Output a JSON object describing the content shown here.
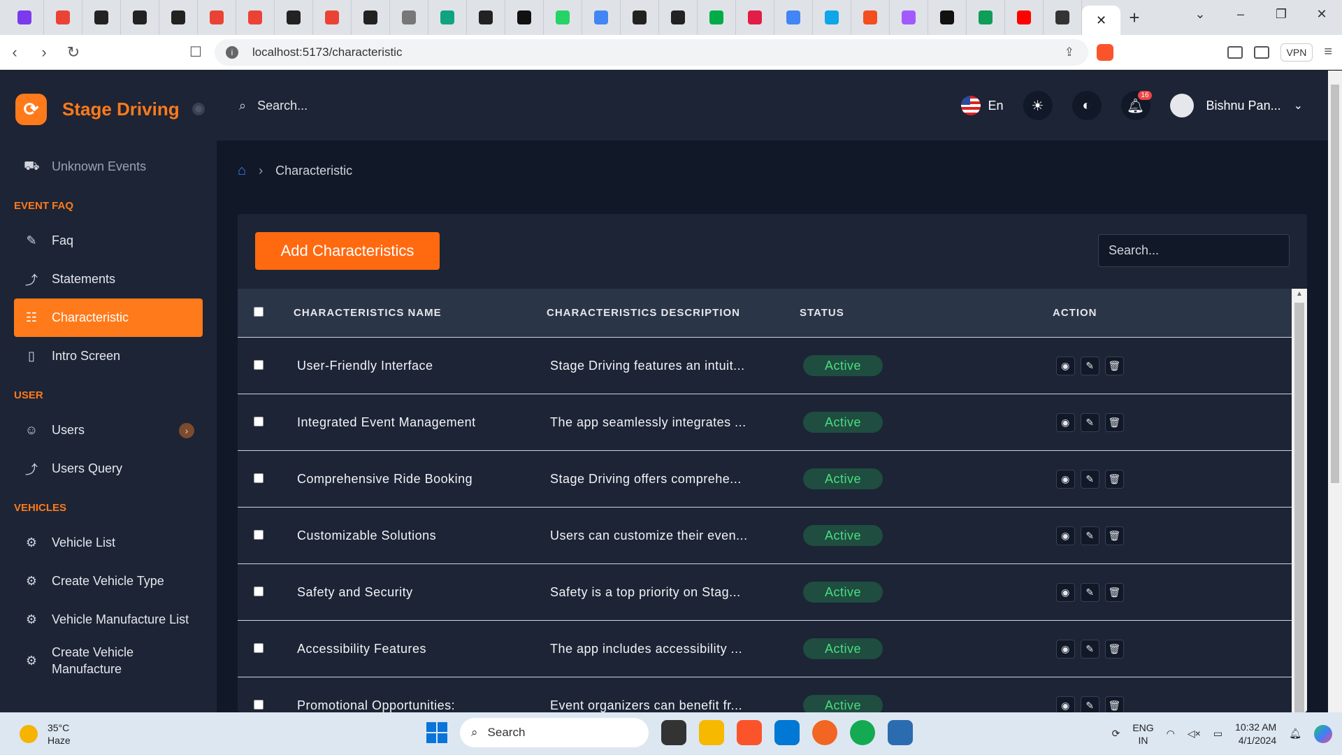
{
  "browser": {
    "tab_icons": [
      "app-icon",
      "gmail-icon",
      "github-icon",
      "github-icon",
      "github-icon",
      "gmail-icon",
      "gmail-icon",
      "github-icon",
      "gmail-icon",
      "github-icon",
      "globe-icon",
      "chatgpt-icon",
      "github-icon",
      "ycombinator-icon",
      "whatsapp-icon",
      "docs-icon",
      "github-icon",
      "github-icon",
      "meet-icon",
      "notion-icon",
      "docs-icon",
      "app-icon",
      "figma-icon",
      "figma-icon",
      "mongodb-icon",
      "sheets-icon",
      "youtube-icon",
      "compass-icon"
    ],
    "tab_colors": [
      "#7c3aed",
      "#ea4335",
      "#222",
      "#222",
      "#222",
      "#ea4335",
      "#ea4335",
      "#222",
      "#ea4335",
      "#222",
      "#777",
      "#10a37f",
      "#222",
      "#111",
      "#25d366",
      "#4285f4",
      "#222",
      "#222",
      "#00ac47",
      "#e11d48",
      "#4285f4",
      "#0ea5e9",
      "#f24e1e",
      "#a259ff",
      "#111",
      "#0f9d58",
      "#ff0000",
      "#333"
    ],
    "url": "localhost:5173/characteristic",
    "vpn_label": "VPN",
    "new_tab": "+",
    "close_tab": "✕"
  },
  "app": {
    "brand_name": "Stage Driving",
    "search_placeholder": "Search...",
    "language": "En",
    "notifications_count": "16",
    "user_name": "Bishnu Pan...",
    "sidebar": {
      "items_top": [
        {
          "label": "Unknown Events",
          "icon": "⛟"
        }
      ],
      "sections": [
        {
          "title": "EVENT FAQ",
          "items": [
            {
              "label": "Faq",
              "icon": "✎"
            },
            {
              "label": "Statements",
              "icon": "⤴"
            },
            {
              "label": "Characteristic",
              "icon": "☷",
              "active": true
            },
            {
              "label": "Intro Screen",
              "icon": "▯"
            }
          ]
        },
        {
          "title": "USER",
          "items": [
            {
              "label": "Users",
              "icon": "☺",
              "chevron": "›"
            },
            {
              "label": "Users Query",
              "icon": "⤴"
            }
          ]
        },
        {
          "title": "VEHICLES",
          "items": [
            {
              "label": "Vehicle List",
              "icon": "⚙"
            },
            {
              "label": "Create Vehicle Type",
              "icon": "⚙"
            },
            {
              "label": "Vehicle Manufacture List",
              "icon": "⚙"
            },
            {
              "label": "Create Vehicle Manufacture",
              "icon": "⚙"
            }
          ]
        }
      ]
    },
    "breadcrumb": {
      "current": "Characteristic"
    },
    "card": {
      "add_button": "Add Characteristics",
      "search_placeholder": "Search...",
      "columns": [
        "CHARACTERISTICS NAME",
        "CHARACTERISTICS DESCRIPTION",
        "STATUS",
        "ACTION"
      ],
      "rows": [
        {
          "name": "User-Friendly Interface",
          "description": "Stage Driving features an intuit...",
          "status": "Active"
        },
        {
          "name": "Integrated Event Management",
          "description": "The app seamlessly integrates ...",
          "status": "Active"
        },
        {
          "name": "Comprehensive Ride Booking",
          "description": "Stage Driving offers comprehe...",
          "status": "Active"
        },
        {
          "name": "Customizable Solutions",
          "description": "Users can customize their even...",
          "status": "Active"
        },
        {
          "name": "Safety and Security",
          "description": "Safety is a top priority on Stag...",
          "status": "Active"
        },
        {
          "name": "Accessibility Features",
          "description": "The app includes accessibility ...",
          "status": "Active"
        },
        {
          "name": "Promotional Opportunities:",
          "description": "Event organizers can benefit fr...",
          "status": "Active"
        }
      ]
    }
  },
  "taskbar": {
    "temperature": "35°C",
    "weather": "Haze",
    "search_label": "Search",
    "lang_top": "ENG",
    "lang_bottom": "IN",
    "time": "10:32 AM",
    "date": "4/1/2024"
  }
}
